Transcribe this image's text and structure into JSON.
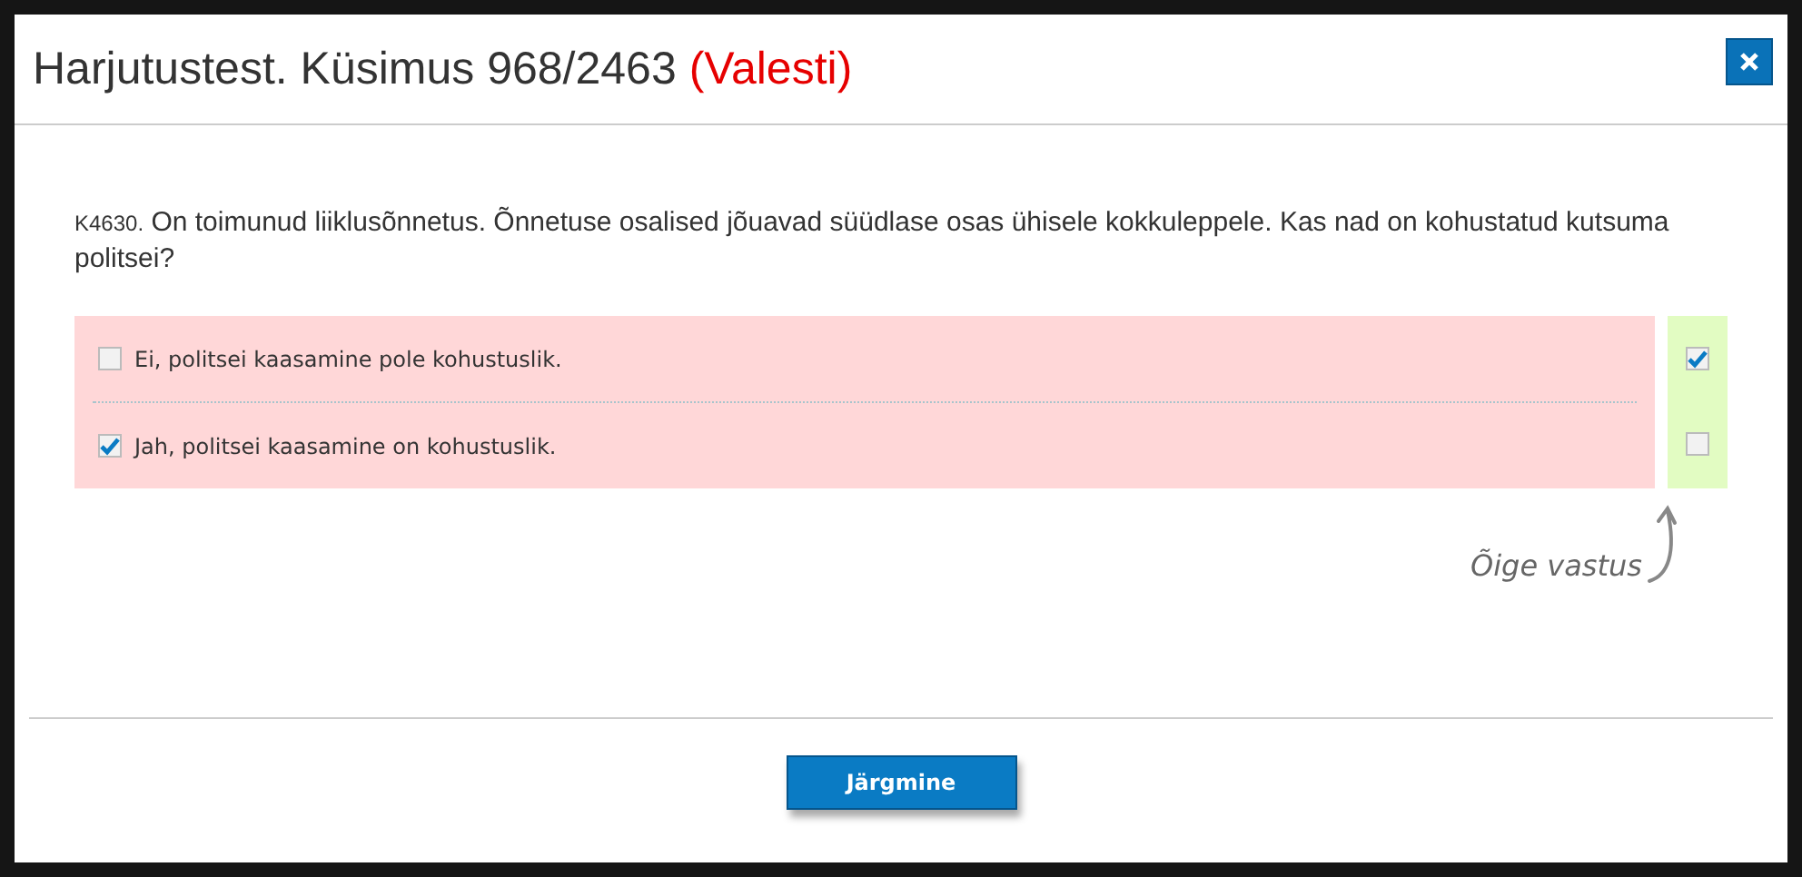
{
  "dialog": {
    "title": "Harjutustest. Küsimus 968/2463",
    "verdict": "(Valesti)",
    "correct": false
  },
  "question": {
    "code": "K4630.",
    "text": "On toimunud liiklusõnnetus. Õnnetuse osalised jõuavad süüdlase osas ühisele kokkuleppele. Kas nad on kohustatud kutsuma politsei?"
  },
  "answers": [
    {
      "text": "Ei, politsei kaasamine pole kohustuslik.",
      "checked": false,
      "correct": true
    },
    {
      "text": "Jah, politsei kaasamine on kohustuslik.",
      "checked": true,
      "correct": false
    }
  ],
  "annotation": "Õige vastus",
  "next_button": "Järgmine"
}
